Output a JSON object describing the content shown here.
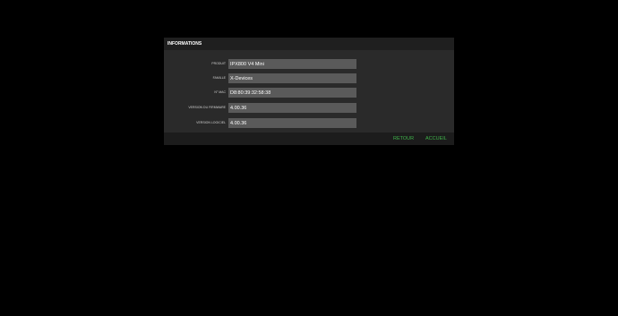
{
  "panel": {
    "title": "INFORMATIONS"
  },
  "fields": [
    {
      "label": "PRODUIT",
      "value": "IPX800 V4 Mini"
    },
    {
      "label": "FAMILLE",
      "value": "X-Devices"
    },
    {
      "label": "N° MAC",
      "value": "D8:80:39:32:58:38"
    },
    {
      "label": "VERSION DU FIRMWARE",
      "value": "4.00.36"
    },
    {
      "label": "VERSION LOGICIEL",
      "value": "4.00.36"
    }
  ],
  "footer": {
    "back_label": "RETOUR",
    "home_label": "ACCUEIL"
  },
  "colors": {
    "accent": "#3fb24a",
    "panel": "#2a2a2a",
    "input": "#5a5a5a"
  }
}
